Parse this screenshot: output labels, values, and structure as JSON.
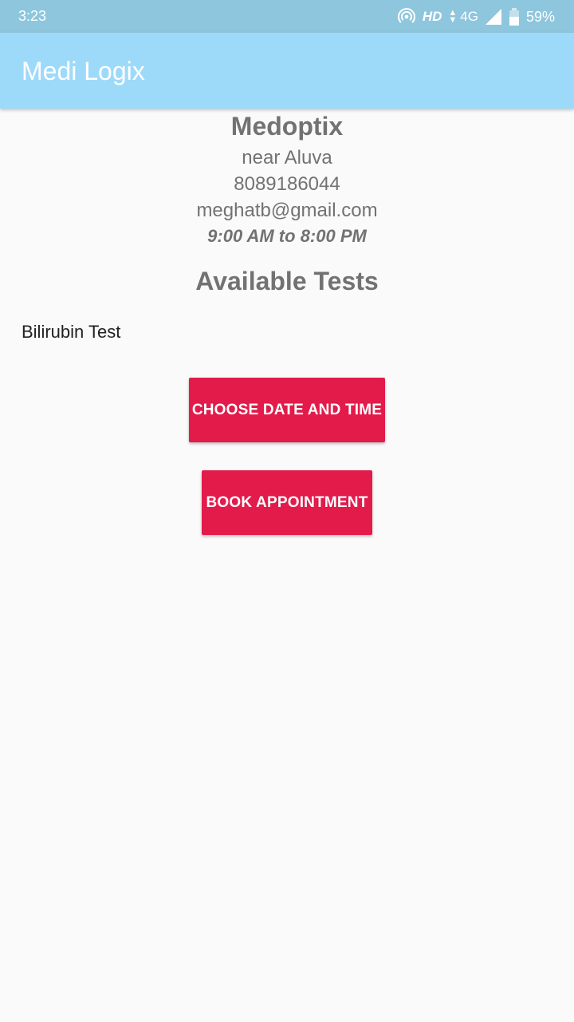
{
  "status_bar": {
    "time": "3:23",
    "network_label": "HD",
    "network_type": "4G",
    "battery": "59%",
    "icons": [
      "hotspot-icon",
      "data-arrows-icon",
      "signal-icon",
      "battery-icon"
    ]
  },
  "app_bar": {
    "title": "Medi Logix",
    "color": "#9ddafa"
  },
  "lab": {
    "name": "Medoptix",
    "location": "near Aluva",
    "phone": "8089186044",
    "email": "meghatb@gmail.com",
    "hours": "9:00 AM to 8:00 PM"
  },
  "tests": {
    "heading": "Available Tests",
    "items": [
      "Bilirubin Test"
    ]
  },
  "actions": {
    "choose_datetime_label": "CHOOSE DATE AND TIME",
    "book_label": "BOOK APPOINTMENT",
    "button_color": "#e21b4b"
  }
}
